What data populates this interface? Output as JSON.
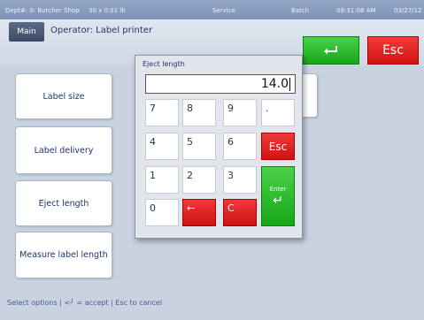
{
  "status_bar": {
    "dept": "Dept#: 0: Butcher Shop",
    "unit": "30 x 0.01 lb",
    "mode": "Service",
    "batch": "Batch",
    "time": "08:31:08 AM",
    "date": "03/27/12"
  },
  "header": {
    "main_label": "Main",
    "operator_title": "Operator: Label printer",
    "enter_icon": "enter-arrow-icon",
    "esc_label": "Esc"
  },
  "options": [
    {
      "label": "Label size"
    },
    {
      "label": "Label delivery"
    },
    {
      "label": "Eject length"
    },
    {
      "label": "Measure label length"
    }
  ],
  "footer": "Select options | <┘ = accept | Esc to cancel",
  "dialog": {
    "title": "Eject length",
    "value": "14.0",
    "keys": {
      "k7": "7",
      "k8": "8",
      "k9": "9",
      "dot": ".",
      "k4": "4",
      "k5": "5",
      "k6": "6",
      "esc": "Esc",
      "k1": "1",
      "k2": "2",
      "k3": "3",
      "enter": "Enter",
      "k0": "0",
      "back": "←",
      "clear": "C"
    }
  },
  "colors": {
    "accept_green": "#1db51d",
    "cancel_red": "#e01c1c",
    "background": "#c8d2e1"
  }
}
